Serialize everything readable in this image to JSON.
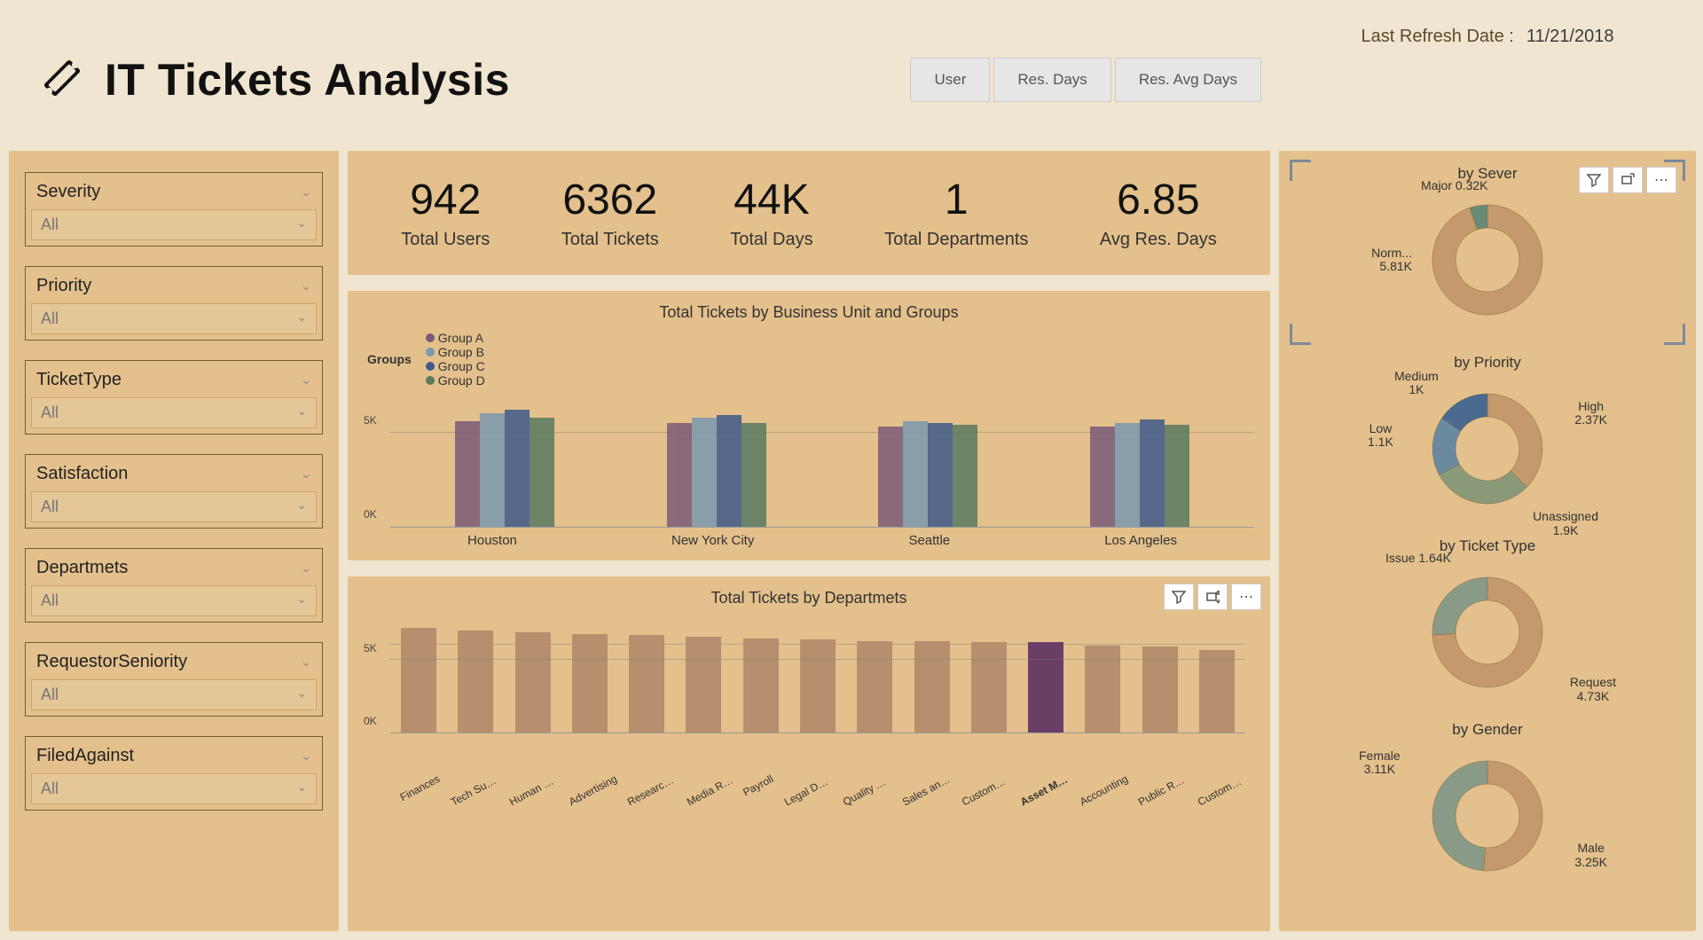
{
  "title": "IT Tickets Analysis",
  "tabs": [
    "User",
    "Res. Days",
    "Res. Avg Days"
  ],
  "refresh": {
    "label": "Last Refresh Date :",
    "value": "11/21/2018"
  },
  "slicers": [
    {
      "label": "Severity",
      "value": "All"
    },
    {
      "label": "Priority",
      "value": "All"
    },
    {
      "label": "TicketType",
      "value": "All"
    },
    {
      "label": "Satisfaction",
      "value": "All"
    },
    {
      "label": "Departmets",
      "value": "All"
    },
    {
      "label": "RequestorSeniority",
      "value": "All"
    },
    {
      "label": "FiledAgainst",
      "value": "All"
    }
  ],
  "kpis": [
    {
      "value": "942",
      "label": "Total Users"
    },
    {
      "value": "6362",
      "label": "Total Tickets"
    },
    {
      "value": "44K",
      "label": "Total Days"
    },
    {
      "value": "1",
      "label": "Total Departments"
    },
    {
      "value": "6.85",
      "label": "Avg Res. Days"
    }
  ],
  "grouped": {
    "title": "Total Tickets by Business Unit and Groups",
    "legend_label": "Groups",
    "groups": [
      "Group A",
      "Group B",
      "Group C",
      "Group D"
    ],
    "group_colors": [
      "#7a5a78",
      "#7a97b0",
      "#3f5a8a",
      "#5a7a60"
    ]
  },
  "dept": {
    "title": "Total Tickets by Departmets"
  },
  "donuts": {
    "severity": {
      "title": "by Sever",
      "labels": {
        "major": "Major 0.32K",
        "normal_l1": "Norm...",
        "normal_l2": "5.81K"
      }
    },
    "priority": {
      "title": "by Priority",
      "labels": {
        "medium_l1": "Medium",
        "medium_l2": "1K",
        "low_l1": "Low",
        "low_l2": "1.1K",
        "high_l1": "High",
        "high_l2": "2.37K",
        "un_l1": "Unassigned",
        "un_l2": "1.9K"
      }
    },
    "tickettype": {
      "title": "by Ticket Type",
      "labels": {
        "issue": "Issue 1.64K",
        "req_l1": "Request",
        "req_l2": "4.73K"
      }
    },
    "gender": {
      "title": "by Gender",
      "labels": {
        "f_l1": "Female",
        "f_l2": "3.11K",
        "m_l1": "Male",
        "m_l2": "3.25K"
      }
    }
  },
  "chart_data": [
    {
      "type": "bar",
      "title": "Total Tickets by Business Unit and Groups",
      "categories": [
        "Houston",
        "New York City",
        "Seattle",
        "Los Angeles"
      ],
      "series": [
        {
          "name": "Group A",
          "color": "#7a5a78",
          "values": [
            5600,
            5500,
            5300,
            5300
          ]
        },
        {
          "name": "Group B",
          "color": "#7a97b0",
          "values": [
            6000,
            5800,
            5600,
            5500
          ]
        },
        {
          "name": "Group C",
          "color": "#3f5a8a",
          "values": [
            6200,
            5900,
            5500,
            5700
          ]
        },
        {
          "name": "Group D",
          "color": "#5a7a60",
          "values": [
            5800,
            5500,
            5400,
            5400
          ]
        }
      ],
      "ylabel": "",
      "ylim": [
        0,
        7000
      ],
      "y_ticks": [
        0,
        5000
      ],
      "y_tick_labels": [
        "0K",
        "5K"
      ]
    },
    {
      "type": "bar",
      "title": "Total Tickets by Departmets",
      "categories": [
        "Finances",
        "Tech Support",
        "Human Res...",
        "Advertising",
        "Research an...",
        "Media Relati...",
        "Payroll",
        "Legal Depar...",
        "Quality Assu...",
        "Sales and M...",
        "Customer R...",
        "Asset Mana...",
        "Accounting",
        "Public Relati...",
        "Customer S..."
      ],
      "values": [
        7200,
        7000,
        6900,
        6800,
        6700,
        6600,
        6500,
        6400,
        6300,
        6300,
        6200,
        6200,
        6000,
        5900,
        5700
      ],
      "highlight_index": 11,
      "ylim": [
        0,
        8000
      ],
      "y_ticks": [
        0,
        5000
      ],
      "y_tick_labels": [
        "0K",
        "5K"
      ]
    },
    {
      "type": "pie",
      "title": "by Severity",
      "series": [
        {
          "name": "Normal",
          "value": 5810,
          "label": "Norm... 5.81K",
          "color": "#c49a6c"
        },
        {
          "name": "Major",
          "value": 320,
          "label": "Major 0.32K",
          "color": "#6a8a78"
        }
      ]
    },
    {
      "type": "pie",
      "title": "by Priority",
      "series": [
        {
          "name": "High",
          "value": 2370,
          "label": "High 2.37K",
          "color": "#c49a6c"
        },
        {
          "name": "Unassigned",
          "value": 1900,
          "label": "Unassigned 1.9K",
          "color": "#8a9a78"
        },
        {
          "name": "Low",
          "value": 1100,
          "label": "Low 1.1K",
          "color": "#6a8aa0"
        },
        {
          "name": "Medium",
          "value": 1000,
          "label": "Medium 1K",
          "color": "#4a6a90"
        }
      ]
    },
    {
      "type": "pie",
      "title": "by Ticket Type",
      "series": [
        {
          "name": "Request",
          "value": 4730,
          "label": "Request 4.73K",
          "color": "#c49a6c"
        },
        {
          "name": "Issue",
          "value": 1640,
          "label": "Issue 1.64K",
          "color": "#8a9a88"
        }
      ]
    },
    {
      "type": "pie",
      "title": "by Gender",
      "series": [
        {
          "name": "Male",
          "value": 3250,
          "label": "Male 3.25K",
          "color": "#c49a6c"
        },
        {
          "name": "Female",
          "value": 3110,
          "label": "Female 3.11K",
          "color": "#8a9a88"
        }
      ]
    }
  ]
}
